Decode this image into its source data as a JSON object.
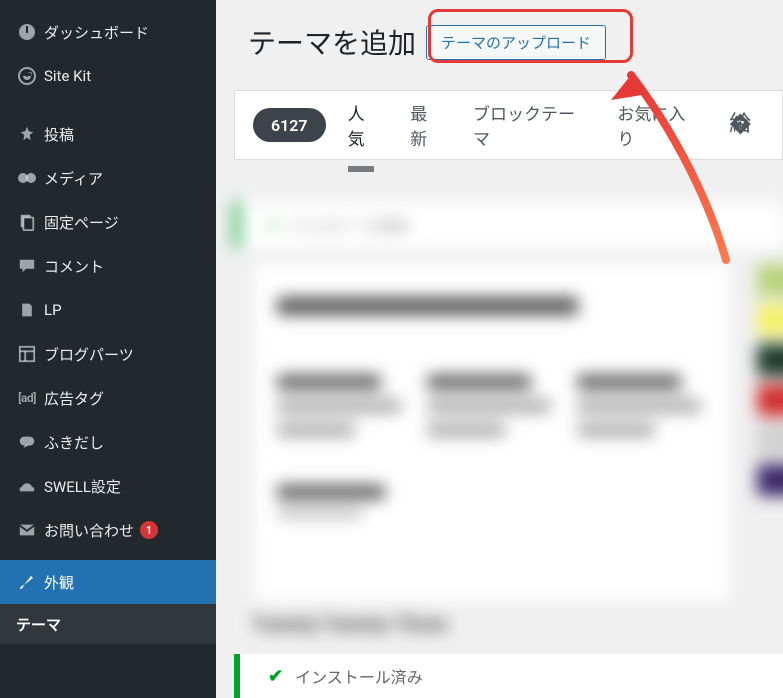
{
  "sidebar": {
    "items": [
      {
        "icon": "dashboard",
        "label": "ダッシュボード"
      },
      {
        "icon": "sitekit",
        "label": "Site Kit"
      },
      {
        "icon": "pin",
        "label": "投稿"
      },
      {
        "icon": "media",
        "label": "メディア"
      },
      {
        "icon": "page",
        "label": "固定ページ"
      },
      {
        "icon": "comment",
        "label": "コメント"
      },
      {
        "icon": "doc",
        "label": "LP"
      },
      {
        "icon": "grid",
        "label": "ブログパーツ"
      },
      {
        "icon": "ad",
        "label": "広告タグ"
      },
      {
        "icon": "chat",
        "label": "ふきだし"
      },
      {
        "icon": "swell",
        "label": "SWELL設定"
      },
      {
        "icon": "mail",
        "label": "お問い合わせ",
        "badge": "1"
      },
      {
        "icon": "brush",
        "label": "外観",
        "active": true
      }
    ],
    "submenu": {
      "label": "テーマ"
    }
  },
  "main": {
    "title": "テーマを追加",
    "upload_button": "テーマのアップロード",
    "tabs": {
      "count": "6127",
      "items": [
        {
          "label": "人気",
          "active": true
        },
        {
          "label": "最新"
        },
        {
          "label": "ブロックテーマ"
        },
        {
          "label": "お気に入り"
        }
      ]
    },
    "notice_installed": "インストール済み",
    "blurred": {
      "card_title": "Twenty Twenty-Three",
      "colors": [
        "#b7d37d",
        "#f4f06a",
        "#1d3b2a",
        "#d13030",
        "#d0d0d0",
        "#3b2a6b"
      ]
    }
  }
}
